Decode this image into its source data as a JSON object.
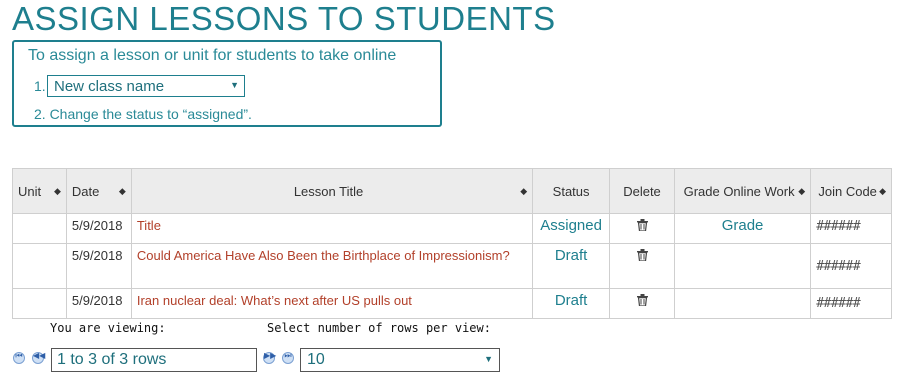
{
  "page_title": "ASSIGN LESSONS TO STUDENTS",
  "instructions": {
    "heading": "To assign a lesson or unit for students to take online",
    "step1_number": "1.",
    "class_select_value": "New class name",
    "step2": "2. Change the status to “assigned”."
  },
  "table": {
    "headers": {
      "unit": "Unit",
      "date": "Date",
      "lesson_title": "Lesson Title",
      "status": "Status",
      "delete": "Delete",
      "grade_online_work": "Grade Online Work",
      "join_code": "Join Code"
    },
    "rows": [
      {
        "unit": "",
        "date": "5/9/2018",
        "title": "Title",
        "status": "Assigned",
        "grade": "Grade",
        "code": "######"
      },
      {
        "unit": "",
        "date": "5/9/2018",
        "title": "Could America Have Also Been the Birthplace of Impressionism?",
        "status": "Draft",
        "grade": "",
        "code": "######"
      },
      {
        "unit": "",
        "date": "5/9/2018",
        "title": "Iran nuclear deal: What’s next after US pulls out",
        "status": "Draft",
        "grade": "",
        "code": "######"
      }
    ]
  },
  "pager": {
    "viewing_label": "You are viewing:",
    "rows_label": "Select number of rows per view:",
    "viewing_value": "1 to 3 of 3 rows",
    "rows_per_view": "10"
  },
  "colors": {
    "accent": "#1e7f8e",
    "link": "#b2402a"
  },
  "icons": {
    "sort": "sort-both-icon",
    "delete": "trash-icon",
    "dropdown": "caret-down-icon"
  }
}
